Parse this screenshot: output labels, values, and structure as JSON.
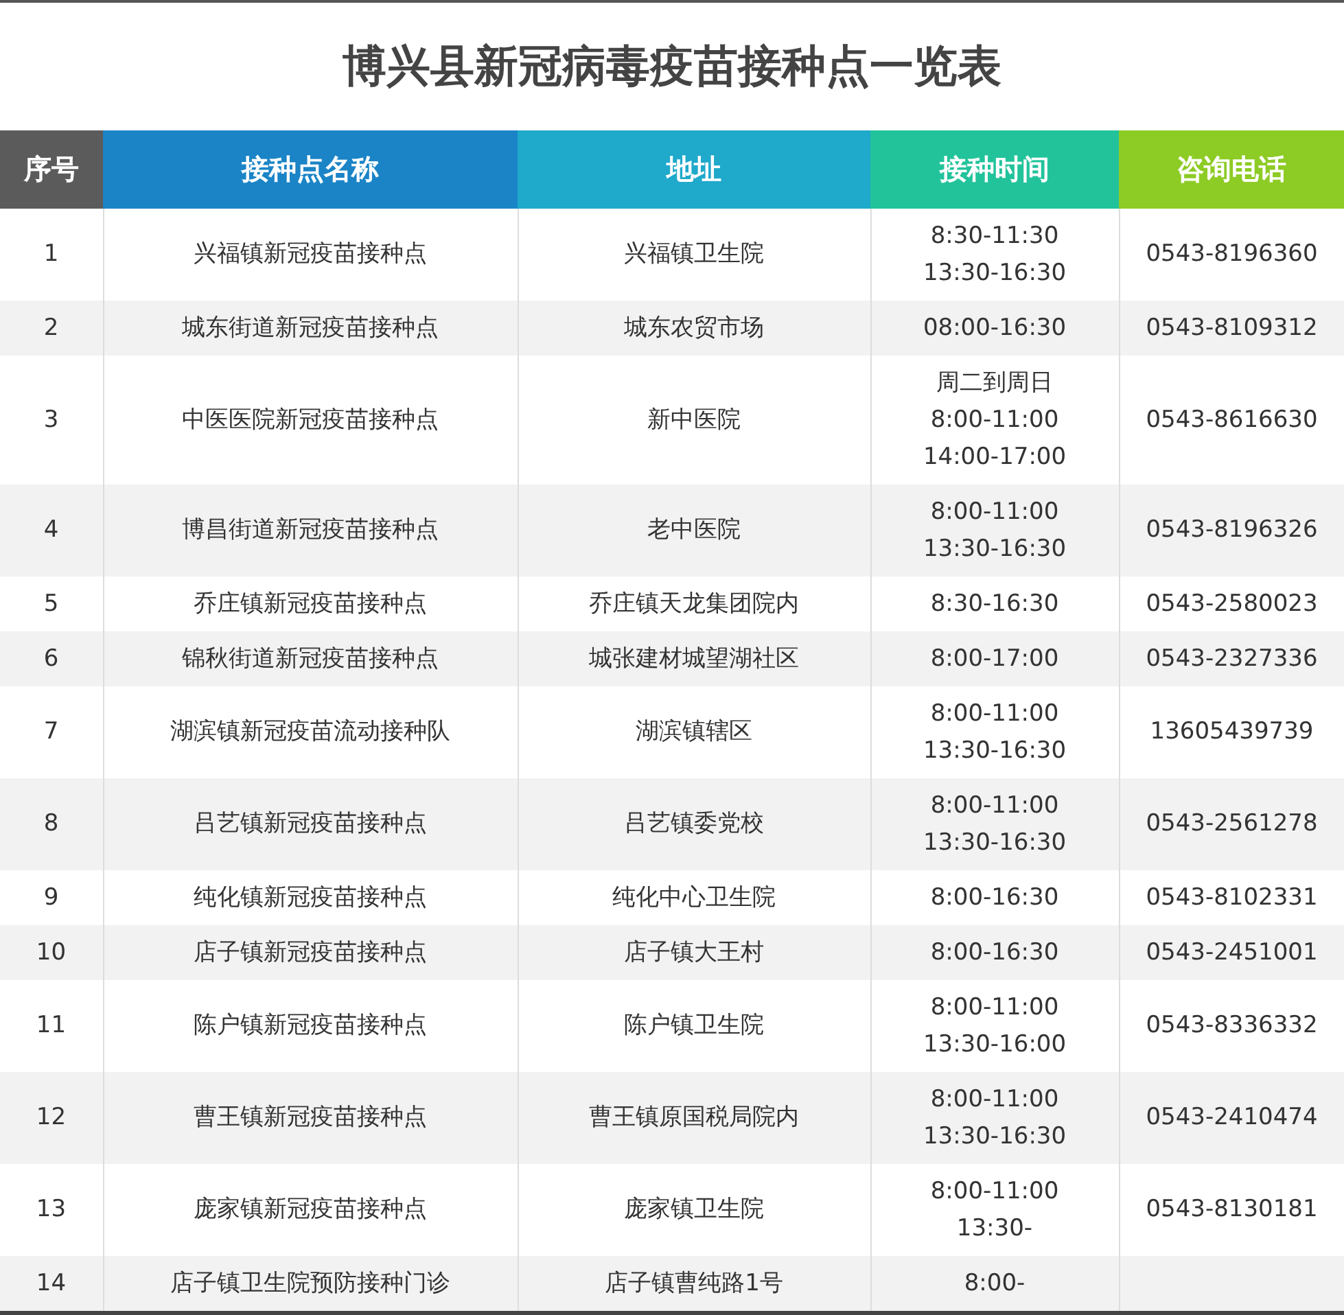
{
  "title": "博兴县新冠病毒疫苗接种点一览表",
  "table": {
    "columns": [
      {
        "label": "序号",
        "color": "#5b5b5b"
      },
      {
        "label": "接种点名称",
        "color": "#1a84c6"
      },
      {
        "label": "地址",
        "color": "#1fa9cb"
      },
      {
        "label": "接种时间",
        "color": "#22c39b"
      },
      {
        "label": "咨询电话",
        "color": "#8dcb25"
      }
    ],
    "rows": [
      {
        "no": "1",
        "name": "兴福镇新冠疫苗接种点",
        "address": "兴福镇卫生院",
        "time": [
          "8:30-11:30",
          "13:30-16:30"
        ],
        "phone": "0543-8196360"
      },
      {
        "no": "2",
        "name": "城东街道新冠疫苗接种点",
        "address": "城东农贸市场",
        "time": [
          "08:00-16:30"
        ],
        "phone": "0543-8109312"
      },
      {
        "no": "3",
        "name": "中医医院新冠疫苗接种点",
        "address": "新中医院",
        "time": [
          "周二到周日",
          "8:00-11:00",
          "14:00-17:00"
        ],
        "phone": "0543-8616630"
      },
      {
        "no": "4",
        "name": "博昌街道新冠疫苗接种点",
        "address": "老中医院",
        "time": [
          "8:00-11:00",
          "13:30-16:30"
        ],
        "phone": "0543-8196326"
      },
      {
        "no": "5",
        "name": "乔庄镇新冠疫苗接种点",
        "address": "乔庄镇天龙集团院内",
        "time": [
          "8:30-16:30"
        ],
        "phone": "0543-2580023"
      },
      {
        "no": "6",
        "name": "锦秋街道新冠疫苗接种点",
        "address": "城张建材城望湖社区",
        "time": [
          "8:00-17:00"
        ],
        "phone": "0543-2327336"
      },
      {
        "no": "7",
        "name": "湖滨镇新冠疫苗流动接种队",
        "address": "湖滨镇辖区",
        "time": [
          "8:00-11:00",
          "13:30-16:30"
        ],
        "phone": "13605439739"
      },
      {
        "no": "8",
        "name": "吕艺镇新冠疫苗接种点",
        "address": "吕艺镇委党校",
        "time": [
          "8:00-11:00",
          "13:30-16:30"
        ],
        "phone": "0543-2561278"
      },
      {
        "no": "9",
        "name": "纯化镇新冠疫苗接种点",
        "address": "纯化中心卫生院",
        "time": [
          "8:00-16:30"
        ],
        "phone": "0543-8102331"
      },
      {
        "no": "10",
        "name": "店子镇新冠疫苗接种点",
        "address": "店子镇大王村",
        "time": [
          "8:00-16:30"
        ],
        "phone": "0543-2451001"
      },
      {
        "no": "11",
        "name": "陈户镇新冠疫苗接种点",
        "address": "陈户镇卫生院",
        "time": [
          "8:00-11:00",
          "13:30-16:00"
        ],
        "phone": "0543-8336332"
      },
      {
        "no": "12",
        "name": "曹王镇新冠疫苗接种点",
        "address": "曹王镇原国税局院内",
        "time": [
          "8:00-11:00",
          "13:30-16:30"
        ],
        "phone": "0543-2410474"
      },
      {
        "no": "13",
        "name": "庞家镇新冠疫苗接种点",
        "address": "庞家镇卫生院",
        "time": [
          "8:00-11:00",
          "13:30-"
        ],
        "phone": "0543-8130181"
      },
      {
        "no": "14",
        "name": "店子镇卫生院预防接种门诊",
        "address": "店子镇曹纯路1号",
        "time": [
          "8:00-"
        ]
      }
    ]
  }
}
